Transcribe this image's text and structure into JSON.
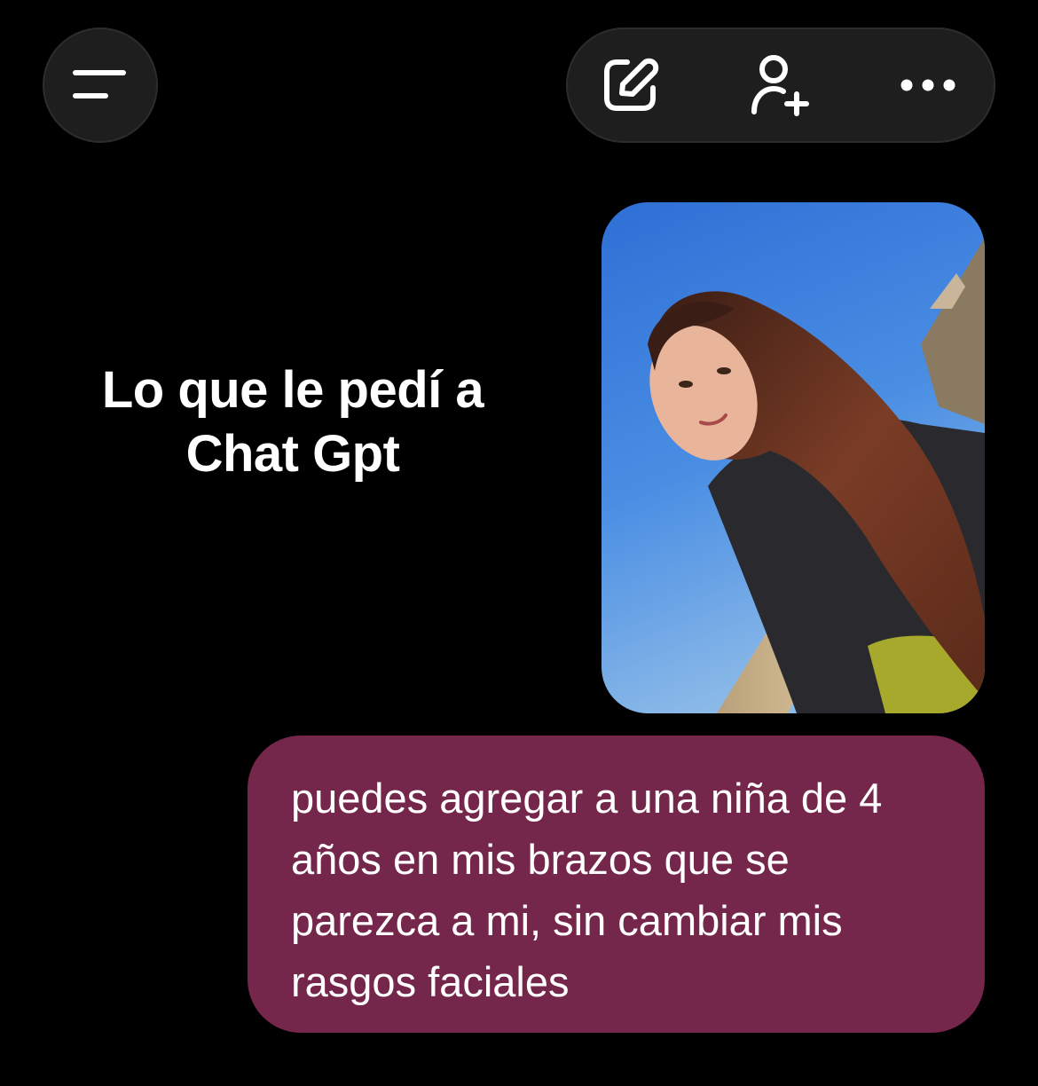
{
  "header": {
    "menu_icon": "hamburger-menu-icon",
    "actions": [
      {
        "icon": "compose-icon",
        "label": "new-chat"
      },
      {
        "icon": "add-person-icon",
        "label": "add-person"
      },
      {
        "icon": "more-horizontal-icon",
        "label": "more-options"
      }
    ]
  },
  "caption": {
    "line1": "Lo que le pedí a",
    "line2": "Chat Gpt"
  },
  "photo": {
    "alt": "Selfie of a young woman with long brown hair outdoors under blue sky"
  },
  "message": {
    "line1": "puedes agregar a una niña de 4",
    "line2": "años en mis brazos que se",
    "line3": "parezca a mi, sin cambiar mis",
    "line4": "rasgos faciales"
  },
  "colors": {
    "background": "#000000",
    "pill": "#1e1e1e",
    "bubble": "#75264b",
    "text": "#ffffff"
  }
}
